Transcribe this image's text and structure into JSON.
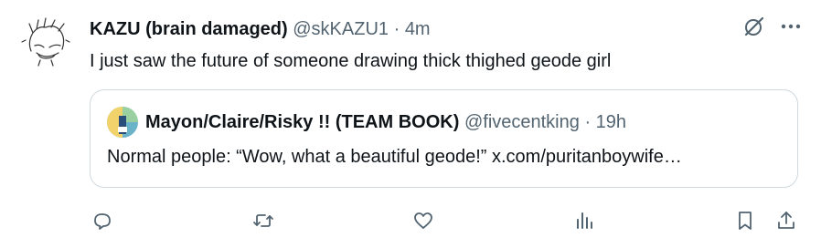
{
  "post": {
    "author_name": "KAZU (brain damaged)",
    "handle": "@skKAZU1",
    "separator": "·",
    "time": "4m",
    "text": "I just saw the future of someone drawing thick thighed geode girl",
    "avatar_icon": "sketch-avatar-icon"
  },
  "quote": {
    "author_name": "Mayon/Claire/Risky !! (TEAM BOOK)",
    "handle": "@fivecentking",
    "separator": "·",
    "time": "19h",
    "text": "Normal people: “Wow, what a beautiful geode!” x.com/puritanboywife…"
  },
  "icons": {
    "grok": "grok-icon",
    "more": "more-icon",
    "reply": "reply-icon",
    "repost": "repost-icon",
    "like": "like-icon",
    "views": "views-icon",
    "bookmark": "bookmark-icon",
    "share": "share-icon"
  },
  "colors": {
    "text": "#0f1419",
    "secondary": "#536471",
    "border": "#cfd9de"
  }
}
